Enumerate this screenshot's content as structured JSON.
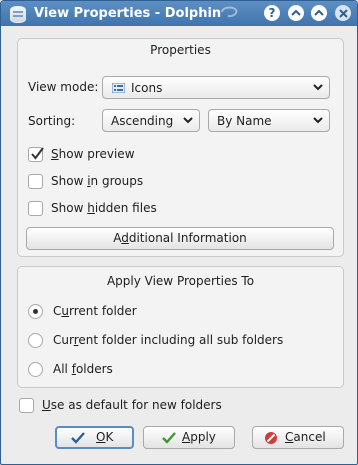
{
  "window": {
    "title": "View Properties - Dolphin",
    "title_icon": "dolphin-app-icon",
    "buttons": {
      "help": "?",
      "minimize": "⌃",
      "maximize": "⌃",
      "close": "✕"
    },
    "accent": "#3f74ad"
  },
  "properties": {
    "title": "Properties",
    "view_mode": {
      "label": "View mode:",
      "value": "Icons",
      "icon": "list-icon"
    },
    "sorting": {
      "label": "Sorting:",
      "order": "Ascending",
      "by": "By Name"
    },
    "options": [
      {
        "pre": "",
        "u": "S",
        "post": "how preview",
        "checked": true
      },
      {
        "pre": "Show ",
        "u": "i",
        "post": "n groups",
        "checked": false
      },
      {
        "pre": "Show ",
        "u": "h",
        "post": "idden files",
        "checked": false
      }
    ],
    "additional": {
      "pre": "A",
      "u": "d",
      "post": "ditional Information"
    }
  },
  "apply_to": {
    "title": "Apply View Properties To",
    "choices": [
      {
        "pre": "C",
        "u": "u",
        "post": "rrent folder",
        "selected": true
      },
      {
        "pre": "Cur",
        "u": "r",
        "post": "ent folder including all sub folders",
        "selected": false
      },
      {
        "pre": "All ",
        "u": "f",
        "post": "olders",
        "selected": false
      }
    ]
  },
  "default_option": {
    "pre": "",
    "u": "U",
    "post": "se as default for new folders",
    "checked": false
  },
  "footer": {
    "ok": {
      "pre": "",
      "u": "O",
      "post": "K",
      "icon": "checkmark-icon"
    },
    "apply": {
      "pre": "",
      "u": "A",
      "post": "pply",
      "icon": "apply-check-icon"
    },
    "cancel": {
      "pre": "",
      "u": "C",
      "post": "ancel",
      "icon": "cancel-icon"
    }
  }
}
